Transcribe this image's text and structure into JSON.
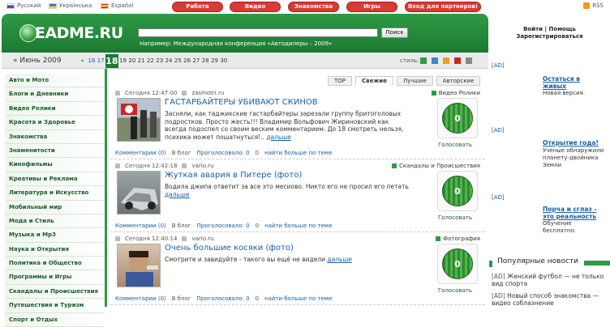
{
  "top": {
    "langs": [
      "Русский",
      "Українська",
      "Español"
    ],
    "buttons": [
      "Работа",
      "Видео",
      "Знакомства",
      "Игры",
      "Вход для партнеров!"
    ],
    "rss": "RSS"
  },
  "header": {
    "logo": "EADME.RU",
    "search_button": "Поиск",
    "example": "Например: Международная конференция «Автодилеры – 2009»"
  },
  "auth": {
    "login": "Войти",
    "help": "Помощь",
    "register": "Зарегистрироваться",
    "sep": "|"
  },
  "datebar": {
    "month": "« Июнь 2009",
    "prev": "«",
    "days_before": [
      "16",
      "17"
    ],
    "current": "18",
    "days_after": [
      "19",
      "20",
      "21",
      "22",
      "23",
      "24",
      "25",
      "26",
      "27",
      "28",
      "29",
      "30"
    ],
    "style_label": "стиль:",
    "swatch_colors": [
      "#2f9a45",
      "#3b86c8",
      "#e6a020",
      "#c8281e",
      "#888888"
    ]
  },
  "sidebar": [
    "Авто и Мото",
    "Блоги и Дневники",
    "Видео Ролики",
    "Красота и Здоровье",
    "Знакомства",
    "Знаменитости",
    "Кинофильмы",
    "Креативы и Реклама",
    "Литература и Искусство",
    "Мобильный мир",
    "Мода и Стиль",
    "Музыка и Mp3",
    "Наука и Открытия",
    "Политика и Общество",
    "Программы и Игры",
    "Скандалы и Происшествия",
    "Путешествия и Туризм",
    "Спорт и Отдых"
  ],
  "tabs": [
    "TOP",
    "Свежие",
    "Лучшие",
    "Авторские"
  ],
  "posts": [
    {
      "time": "Сегодня 12:47:00",
      "source": "zasmotri.ru",
      "category": "Видео Ролики",
      "title": "ГАСТАРБАЙТЕРЫ УБИВАЮТ СКИНОВ",
      "text": "Засняли, как таджикские гастарбайтеры зарезали группу бритоголовых подростков. Просто жесть!!! Владимир Вольфович Жириновский как всегда подоспел со своим веским комментарием. До 18 смотреть нельзя, психика может пошатнуться!..",
      "more": "дальше",
      "votes": "0",
      "vote_label": "Голосовать",
      "comments": "Комментарии (0)",
      "blog": "В блог",
      "voted": "Проголосовало: 0",
      "find": "найти больше по теме",
      "actions_count": "0"
    },
    {
      "time": "Сегодня 12:42:18",
      "source": "vario.ru",
      "category": "Скандалы и Происшествия",
      "title": "Жуткая авария в Питере (фото)",
      "text": "Водила джипа ответит за все это месиово. Никто его не просил его петать",
      "more": "дальше",
      "votes": "0",
      "vote_label": "Голосовать",
      "comments": "Комментарии (0)",
      "blog": "В блог",
      "voted": "Проголосовало: 0",
      "find": "найти больше по теме",
      "actions_count": "0"
    },
    {
      "time": "Сегодня 12:40:14",
      "source": "vario.ru",
      "category": "Фотография",
      "title": "Очень большие косяки (фото)",
      "text": "Смотрите и завидуйте - такого вы ещё не видели",
      "more": "дальше",
      "votes": "0",
      "vote_label": "Голосовать",
      "comments": "Комментарии (0)",
      "blog": "В блог",
      "voted": "Проголосовало: 0",
      "find": "найти больше по теме",
      "actions_count": "0"
    }
  ],
  "right": {
    "ad_tag": "[AD]",
    "items": [
      {
        "head": "Остаться в живых",
        "sub": "Новая версия."
      },
      {
        "head": "Открытие года!",
        "sub": "Ученые обнаружили планету-двойника Земли"
      },
      {
        "head": "Порча и сглаз - это реальность",
        "sub": "Обучение бесплатно."
      }
    ],
    "popular_title": "Популярные новости",
    "popular": [
      "Женский футбол — не только вид спорта",
      "Новый способ знакомства — видео соблазнение"
    ]
  }
}
